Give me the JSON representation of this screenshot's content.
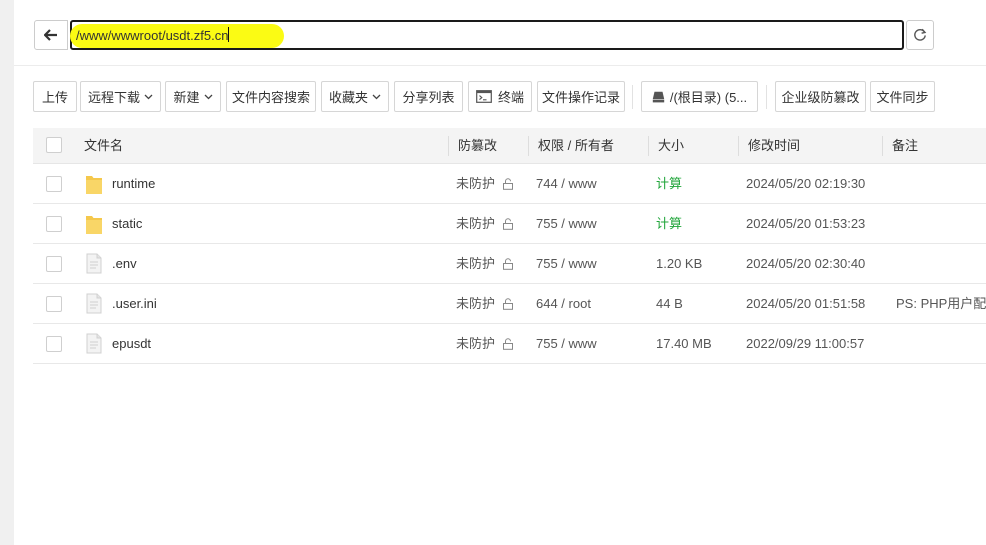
{
  "address_bar": {
    "path": "/www/wwwroot/usdt.zf5.cn"
  },
  "toolbar": {
    "upload": "上传",
    "remote_download": "远程下载",
    "new": "新建",
    "content_search": "文件内容搜索",
    "favorites": "收藏夹",
    "share_list": "分享列表",
    "terminal": "终端",
    "op_log": "文件操作记录",
    "root_dir": "/(根目录) (5...",
    "enterprise_tamper": "企业级防篡改",
    "file_sync": "文件同步"
  },
  "table": {
    "headers": {
      "name": "文件名",
      "tamper": "防篡改",
      "permission": "权限 / 所有者",
      "size": "大小",
      "mtime": "修改时间",
      "note": "备注"
    },
    "rows": [
      {
        "type": "folder",
        "name": "runtime",
        "tamper": "未防护",
        "permission": "744 / www",
        "size": "计算",
        "mtime": "2024/05/20 02:19:30",
        "note": ""
      },
      {
        "type": "folder",
        "name": "static",
        "tamper": "未防护",
        "permission": "755 / www",
        "size": "计算",
        "mtime": "2024/05/20 01:53:23",
        "note": ""
      },
      {
        "type": "file",
        "name": ".env",
        "tamper": "未防护",
        "permission": "755 / www",
        "size": "1.20 KB",
        "mtime": "2024/05/20 02:30:40",
        "note": ""
      },
      {
        "type": "file",
        "name": ".user.ini",
        "tamper": "未防护",
        "permission": "644 / root",
        "size": "44 B",
        "mtime": "2024/05/20 01:51:58",
        "note": "PS: PHP用户配置"
      },
      {
        "type": "file",
        "name": "epusdt",
        "tamper": "未防护",
        "permission": "755 / www",
        "size": "17.40 MB",
        "mtime": "2022/09/29 11:00:57",
        "note": ""
      }
    ]
  },
  "colors": {
    "highlight": "#fbfb14",
    "calc_link": "#20a53a",
    "folder": "#f5c84c"
  },
  "icons": {
    "back": "arrow-left-icon",
    "refresh": "refresh-icon",
    "terminal": "terminal-icon",
    "disk": "disk-icon",
    "folder": "folder-icon",
    "file": "file-icon",
    "lock": "unlock-icon",
    "dropdown": "chevron-down-icon"
  }
}
